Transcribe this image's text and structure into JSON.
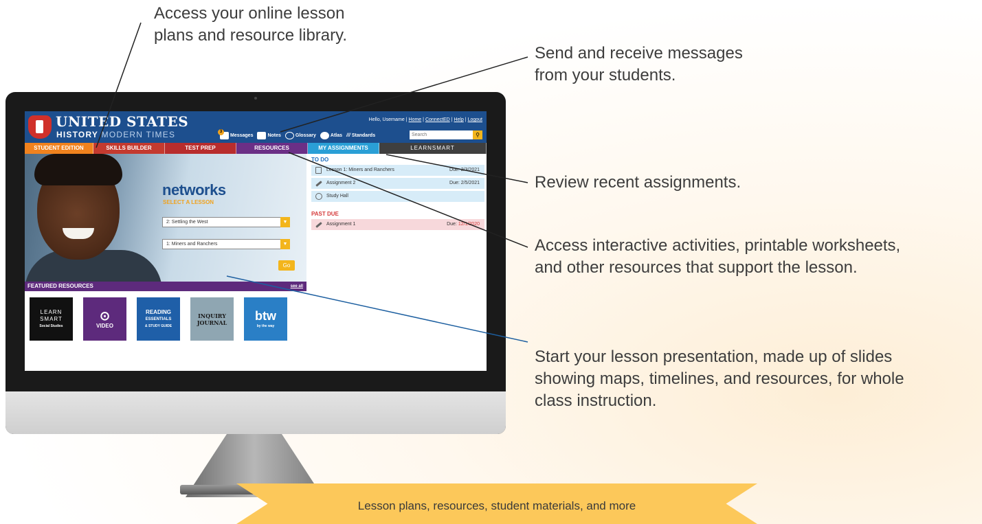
{
  "callouts": {
    "lesson_plans": [
      "Access your online lesson",
      "plans and resource library."
    ],
    "messages": [
      "Send and receive messages",
      "from your students."
    ],
    "assignments": [
      "Review recent assignments."
    ],
    "resources": [
      "Access interactive activities, printable worksheets,",
      "and other resources that support the lesson."
    ],
    "presentation": [
      "Start your lesson presentation, made up of slides",
      "showing maps, timelines, and resources, for whole",
      "class instruction."
    ]
  },
  "banner": "Lesson plans, resources, student materials, and more",
  "app": {
    "title": "UNITED STATES",
    "subtitle_bold": "HISTORY",
    "subtitle_light": "MODERN TIMES",
    "user_links": {
      "greeting": "Hello, Username",
      "home": "Home",
      "connected": "ConnectED",
      "help": "Help",
      "logout": "Logout"
    },
    "toolbar": {
      "messages": "Messages",
      "messages_count": "3",
      "notes": "Notes",
      "glossary": "Glossary",
      "atlas": "Atlas",
      "standards": "Standards"
    },
    "search_placeholder": "Search",
    "nav": [
      {
        "label": "STUDENT EDITION",
        "color": "#f0821e"
      },
      {
        "label": "SKILLS BUILDER",
        "color": "#c43a2f"
      },
      {
        "label": "TEST PREP",
        "color": "#b82d2d"
      },
      {
        "label": "RESOURCES",
        "color": "#6b2f86"
      },
      {
        "label": "MY ASSIGNMENTS",
        "color": "#2a9fd6"
      },
      {
        "label": "LEARNSMART",
        "color": "#3f3f3f"
      }
    ],
    "hero": {
      "logo": "networks",
      "select_label": "SELECT A LESSON",
      "chapter_select": "2: Settling the West",
      "lesson_select": "1: Miners and Ranchers",
      "go": "Go"
    },
    "featured": {
      "title": "FEATURED RESOURCES",
      "see_all": "see all",
      "items": [
        {
          "line1": "LEARN",
          "line2": "SMART",
          "line3": "Social Studies",
          "color": "#111111"
        },
        {
          "line1": "⊙",
          "line2": "VIDEO",
          "line3": "",
          "color": "#5d2a7c"
        },
        {
          "line1": "READING",
          "line2": "ESSENTIALS",
          "line3": "& STUDY GUIDE",
          "color": "#1f5fa8"
        },
        {
          "line1": "INQUIRY",
          "line2": "JOURNAL",
          "line3": "",
          "color": "#8fa6b2"
        },
        {
          "line1": "btw",
          "line2": "by the way",
          "line3": "",
          "color": "#2a7fc6"
        }
      ]
    },
    "todo": {
      "title": "TO DO",
      "items": [
        {
          "label": "Lesson 1: Miners and Ranchers",
          "due": "Due: 2/3/2021",
          "icon": "document-icon"
        },
        {
          "label": "Assignment 2",
          "due": "Due: 2/5/2021",
          "icon": "pencil-icon"
        },
        {
          "label": "Study Hall",
          "due": "",
          "icon": "clock-icon"
        }
      ]
    },
    "past_due": {
      "title": "PAST DUE",
      "items": [
        {
          "label": "Assignment 1",
          "due_prefix": "Due:",
          "due_date": "12/1/2020",
          "icon": "pencil-icon"
        }
      ]
    }
  }
}
